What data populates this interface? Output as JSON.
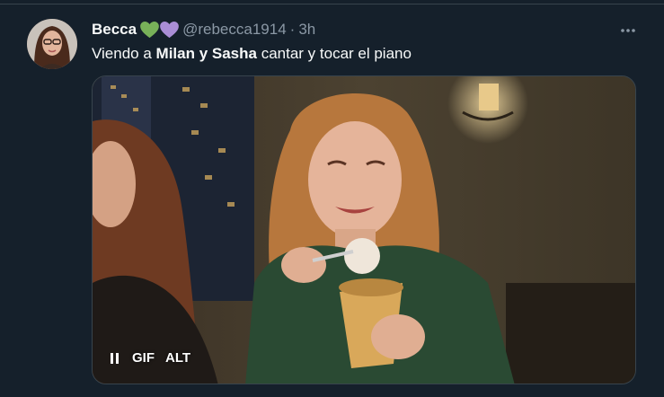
{
  "tweet": {
    "author_name": "Becca",
    "handle": "@rebecca1914",
    "separator": "·",
    "time": "3h",
    "text_prefix": "Viendo a ",
    "text_bold": "Milan y Sasha",
    "text_suffix": " cantar y tocar el piano",
    "hearts": [
      "green-heart-icon",
      "purple-heart-icon"
    ]
  },
  "media": {
    "type_label": "GIF",
    "alt_label": "ALT"
  },
  "colors": {
    "background": "#15202b",
    "secondary_text": "#8b98a5",
    "border": "#38444d",
    "green_heart": "#78b159",
    "purple_heart": "#aa8ed6"
  }
}
